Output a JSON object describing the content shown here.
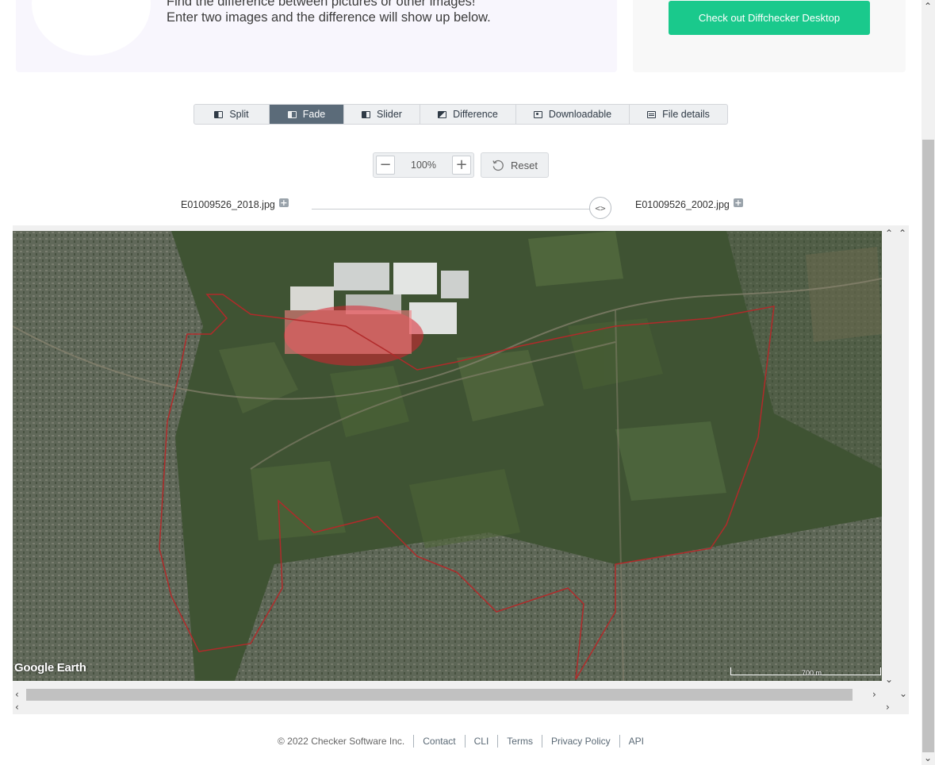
{
  "intro": {
    "line1": "Find the difference between pictures or other images!",
    "line2": "Enter two images and the difference will show up below."
  },
  "desktop_cta": {
    "label": "Check out Diffchecker Desktop",
    "color": "#1ac98c"
  },
  "view_tabs": [
    {
      "label": "Split",
      "icon": "split-view-icon",
      "active": false
    },
    {
      "label": "Fade",
      "icon": "fade-view-icon",
      "active": true
    },
    {
      "label": "Slider",
      "icon": "slider-view-icon",
      "active": false
    },
    {
      "label": "Difference",
      "icon": "difference-view-icon",
      "active": false
    },
    {
      "label": "Downloadable",
      "icon": "download-view-icon",
      "active": false
    },
    {
      "label": "File details",
      "icon": "file-details-icon",
      "active": false
    }
  ],
  "zoom": {
    "minus": "−",
    "value": "100%",
    "plus": "+",
    "reset_label": "Reset"
  },
  "files": {
    "left_name": "E01009526_2018.jpg",
    "right_name": "E01009526_2002.jpg",
    "slider_handle": "<>"
  },
  "map": {
    "watermark": "Google Earth",
    "scale_label": "700 m",
    "highlight_color": "#d9232f"
  },
  "scroll_arrows": {
    "up": "⌃",
    "down": "⌄",
    "left": "‹",
    "right": "›"
  },
  "footer": {
    "copyright": "© 2022 Checker Software Inc.",
    "links": [
      "Contact",
      "CLI",
      "Terms",
      "Privacy Policy",
      "API"
    ]
  }
}
